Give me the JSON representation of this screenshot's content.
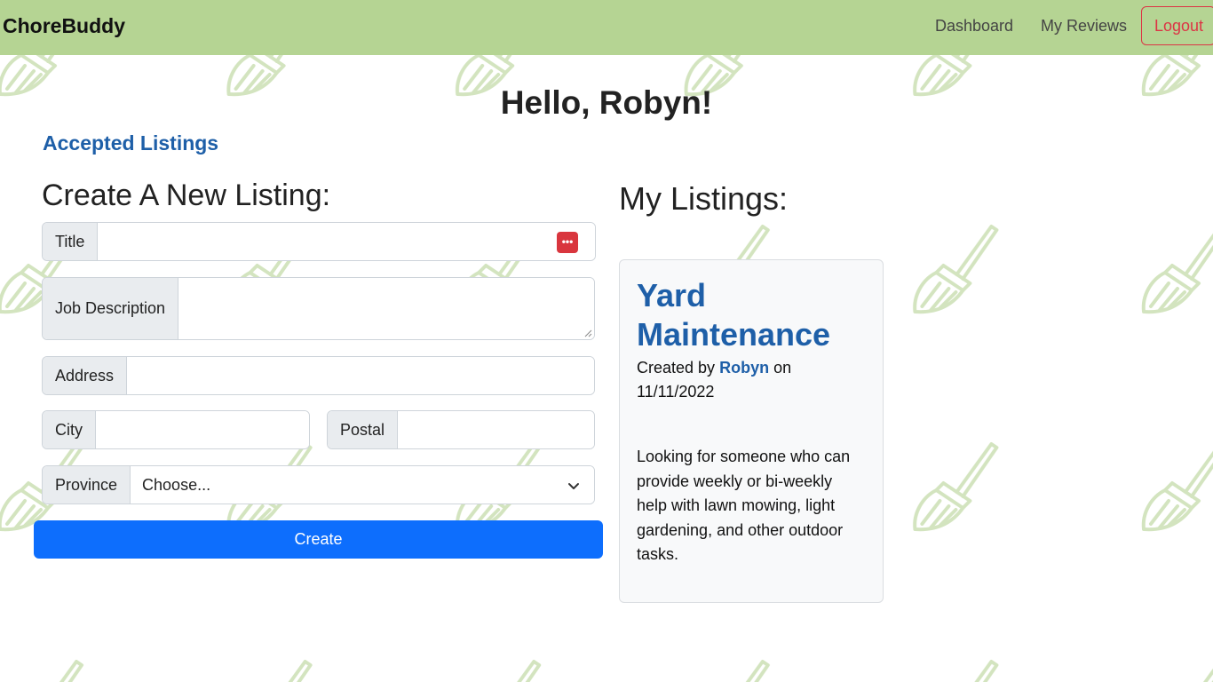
{
  "app": {
    "brand": "ChoreBuddy"
  },
  "nav": {
    "dashboard": "Dashboard",
    "reviews": "My Reviews",
    "logout": "Logout"
  },
  "greeting": "Hello, Robyn!",
  "accepted_link": "Accepted Listings",
  "form": {
    "heading": "Create A New Listing:",
    "title_label": "Title",
    "description_label": "Job Description",
    "address_label": "Address",
    "city_label": "City",
    "postal_label": "Postal",
    "province_label": "Province",
    "province_value": "Choose...",
    "submit_label": "Create"
  },
  "listings": {
    "heading": "My Listings:",
    "items": [
      {
        "title": "Yard Maintenance",
        "created_by_prefix": "Created by",
        "author": "Robyn",
        "on_word": "on",
        "date": "11/11/2022",
        "description": "Looking for someone who can provide weekly or bi-weekly help with lawn mowing, light gardening, and other outdoor tasks."
      }
    ]
  },
  "colors": {
    "navbar": "#b5d493",
    "link": "#1e5fa8",
    "primary": "#0d6efd",
    "danger": "#dc3545",
    "pattern": "#d3e4bf"
  },
  "icons": {
    "background": "broom-icon",
    "password_manager": "password-manager-icon",
    "select": "chevron-down-icon"
  }
}
